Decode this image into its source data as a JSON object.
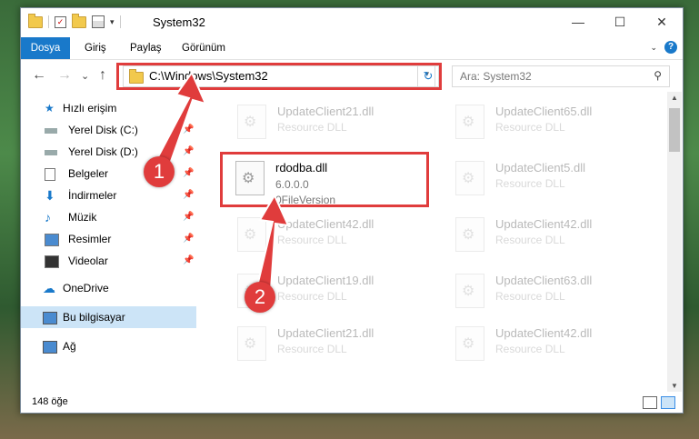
{
  "window": {
    "title": "System32",
    "controls": [
      "minimize-icon",
      "maximize-icon",
      "close-icon"
    ]
  },
  "ribbon": {
    "tabs": [
      "Dosya",
      "Giriş",
      "Paylaş",
      "Görünüm"
    ]
  },
  "nav": {
    "back": "←",
    "forward": "→",
    "recent": "⌄",
    "up": "↑"
  },
  "address": {
    "path": "C:\\Windows\\System32",
    "refresh_glyph": "↻"
  },
  "search": {
    "placeholder": "Ara: System32"
  },
  "sidebar": {
    "items": [
      {
        "label": "Hızlı erişim",
        "icon": "star-icon"
      },
      {
        "label": "Yerel Disk (C:)",
        "icon": "drive-icon",
        "pinned": true
      },
      {
        "label": "Yerel Disk (D:)",
        "icon": "drive-icon",
        "pinned": true
      },
      {
        "label": "Belgeler",
        "icon": "document-icon",
        "pinned": true
      },
      {
        "label": "İndirmeler",
        "icon": "download-icon",
        "pinned": true
      },
      {
        "label": "Müzik",
        "icon": "music-icon",
        "pinned": true
      },
      {
        "label": "Resimler",
        "icon": "pictures-icon",
        "pinned": true
      },
      {
        "label": "Videolar",
        "icon": "video-icon",
        "pinned": true
      },
      {
        "label": "OneDrive",
        "icon": "cloud-icon"
      },
      {
        "label": "Bu bilgisayar",
        "icon": "computer-icon",
        "selected": true
      },
      {
        "label": "Ağ",
        "icon": "network-icon"
      }
    ]
  },
  "files": [
    {
      "name": "UpdateClient21.dll",
      "type": "Resource DLL"
    },
    {
      "name": "UpdateClient65.dll",
      "type": "Resource DLL"
    },
    {
      "name": "rdodba.dll",
      "version": "6.0.0.0",
      "desc": "0FileVersion"
    },
    {
      "name": "UpdateClient5.dll",
      "type": "Resource DLL"
    },
    {
      "name": "UpdateClient42.dll",
      "type": "Resource DLL"
    },
    {
      "name": "UpdateClient42.dll",
      "type": "Resource DLL"
    },
    {
      "name": "UpdateClient19.dll",
      "type": "Resource DLL"
    },
    {
      "name": "UpdateClient63.dll",
      "type": "Resource DLL"
    },
    {
      "name": "UpdateClient21.dll",
      "type": "Resource DLL"
    },
    {
      "name": "UpdateClient42.dll",
      "type": "Resource DLL"
    }
  ],
  "status": {
    "count": "148 öğe"
  },
  "annotations": {
    "badge1": "1",
    "badge2": "2",
    "color": "#e03c3c"
  }
}
